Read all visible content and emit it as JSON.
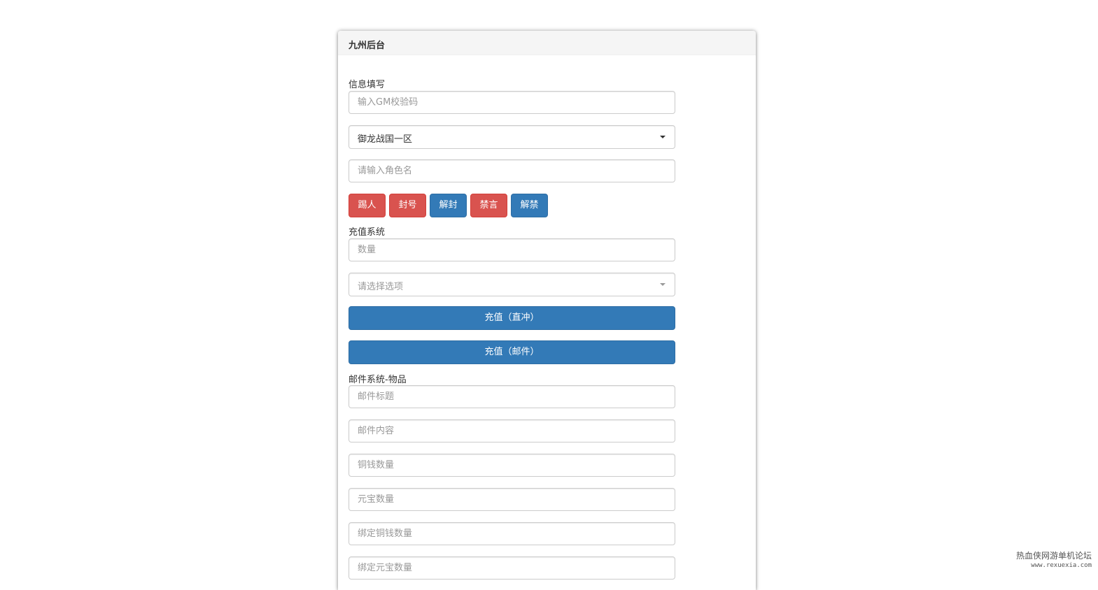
{
  "panel": {
    "title": "九州后台"
  },
  "info_section": {
    "label": "信息填写",
    "gm_code_placeholder": "输入GM校验码",
    "server_select_value": "御龙战国一区",
    "role_name_placeholder": "请输入角色名",
    "actions": [
      {
        "label": "踢人",
        "color": "#d9534f"
      },
      {
        "label": "封号",
        "color": "#d9534f"
      },
      {
        "label": "解封",
        "color": "#337ab7"
      },
      {
        "label": "禁言",
        "color": "#d9534f"
      },
      {
        "label": "解禁",
        "color": "#337ab7"
      }
    ]
  },
  "recharge_section": {
    "label": "充值系统",
    "amount_placeholder": "数量",
    "option_select_placeholder": "请选择选项",
    "direct_button": "充值（直冲）",
    "mail_button": "充值（邮件）"
  },
  "mail_section": {
    "label": "邮件系统-物品",
    "title_placeholder": "邮件标题",
    "content_placeholder": "邮件内容",
    "copper_placeholder": "铜钱数量",
    "yuanbao_placeholder": "元宝数量",
    "bound_copper_placeholder": "绑定铜钱数量",
    "bound_yuanbao_placeholder": "绑定元宝数量"
  },
  "watermark": {
    "line1": "热血侠网游单机论坛",
    "line2": "www.rexuexia.com"
  },
  "colors": {
    "primary": "#337ab7",
    "danger": "#d9534f"
  }
}
